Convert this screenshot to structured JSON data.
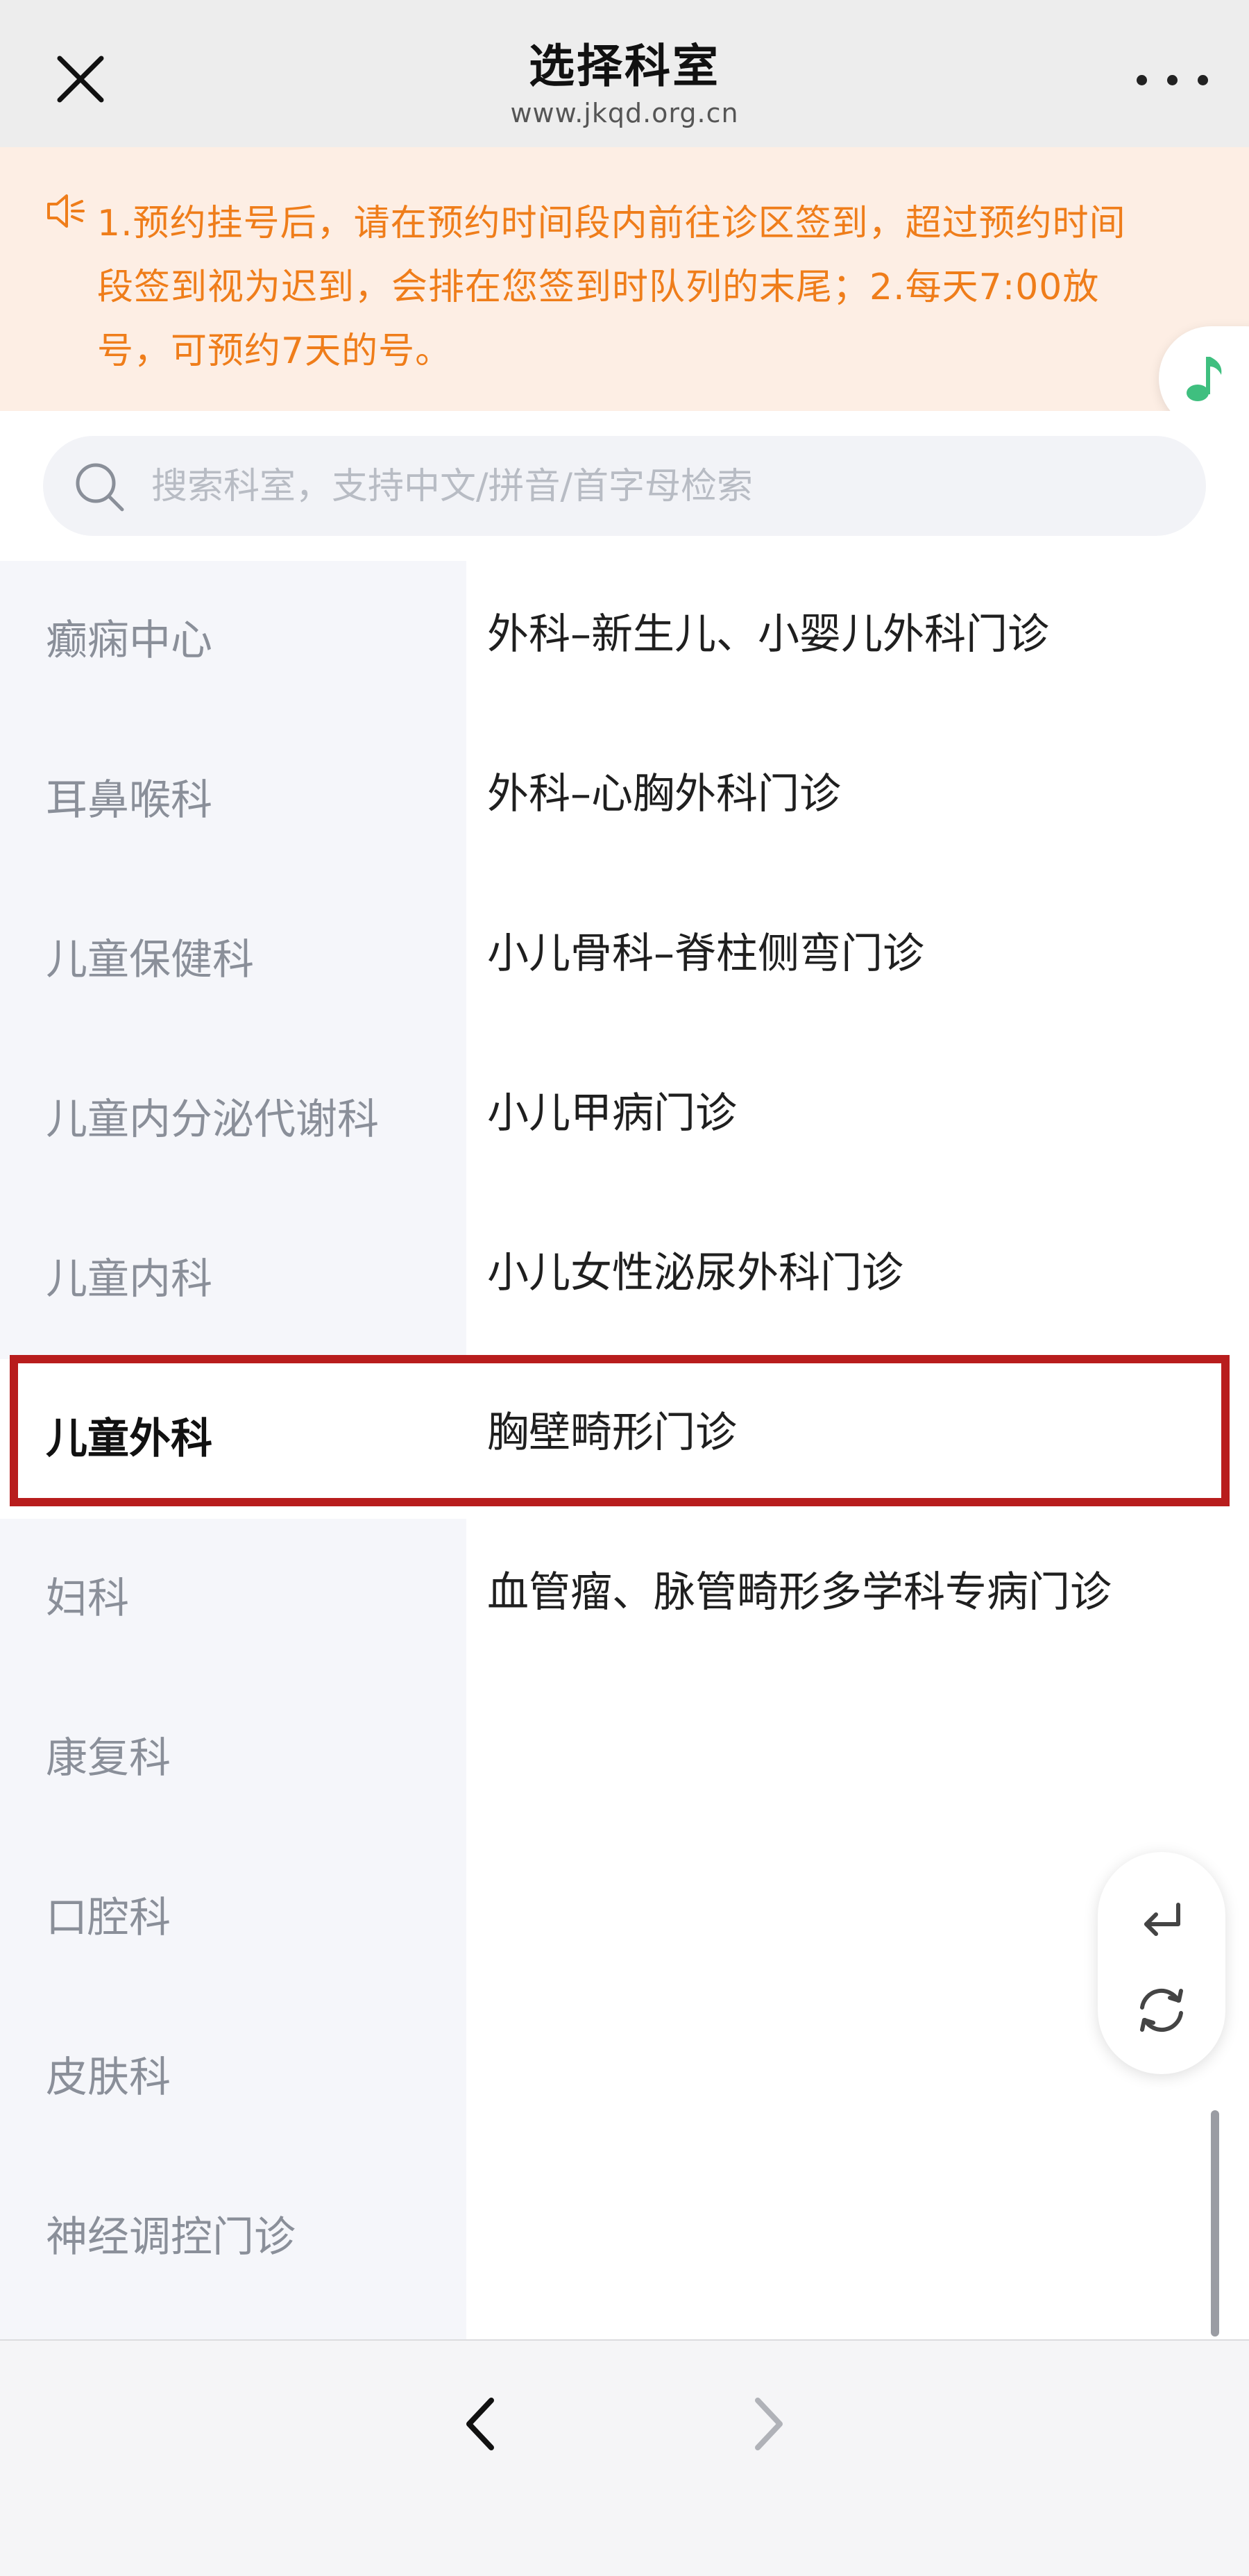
{
  "header": {
    "title": "选择科室",
    "subtitle": "www.jkqd.org.cn",
    "close_icon": "close-icon",
    "more_icon": "more-dots-icon"
  },
  "notice": {
    "lines": [
      "1.预约挂号后，请在预约时间段内前往诊区签到，超过预约时间",
      "段签到视为迟到，会排在您签到时队列的末尾；2.每天7:00放",
      "号，可预约7天的号。"
    ],
    "icon": "speaker-icon",
    "color": "#ef7d1a",
    "background": "#fdeee4"
  },
  "music_button": {
    "icon": "music-note-icon",
    "color": "#3fbf7f"
  },
  "search": {
    "placeholder": "搜索科室，支持中文/拼音/首字母检索",
    "value": ""
  },
  "sidebar": {
    "items": [
      {
        "label": "癫痫中心"
      },
      {
        "label": "耳鼻喉科"
      },
      {
        "label": "儿童保健科"
      },
      {
        "label": "儿童内分泌代谢科"
      },
      {
        "label": "儿童内科"
      },
      {
        "label": "儿童外科",
        "active": true
      },
      {
        "label": "妇科"
      },
      {
        "label": "康复科"
      },
      {
        "label": "口腔科"
      },
      {
        "label": "皮肤科"
      },
      {
        "label": "神经调控门诊"
      }
    ]
  },
  "departments": {
    "items": [
      {
        "label": "外科–新生儿、小婴儿外科门诊"
      },
      {
        "label": "外科–心胸外科门诊"
      },
      {
        "label": "小儿骨科–脊柱侧弯门诊"
      },
      {
        "label": "小儿甲病门诊"
      },
      {
        "label": "小儿女性泌尿外科门诊"
      },
      {
        "label": "胸壁畸形门诊"
      },
      {
        "label": "血管瘤、脉管畸形多学科专病门诊"
      }
    ]
  },
  "highlight": {
    "color": "#b81d1d"
  },
  "float_controls": {
    "icons": [
      "return-icon",
      "refresh-icon"
    ]
  },
  "bottom_nav": {
    "icons": [
      "back-arrow-icon",
      "forward-arrow-icon"
    ]
  }
}
